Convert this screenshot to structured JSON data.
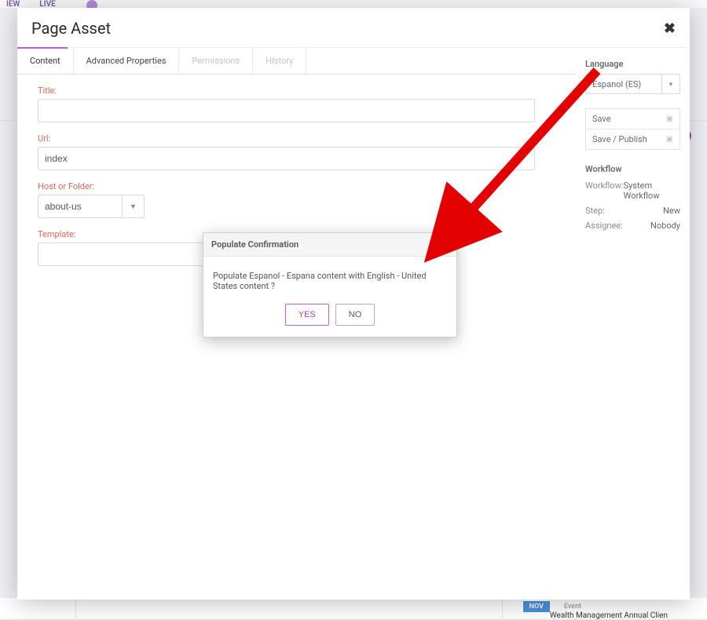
{
  "bg": {
    "tab1": "IEW",
    "tab2": "LIVE",
    "nov_badge": "NOV",
    "event_label": "Event",
    "wm_text": "Wealth Management Annual Clien"
  },
  "modal": {
    "title": "Page Asset",
    "tabs": {
      "content": "Content",
      "advanced": "Advanced Properties",
      "permissions": "Permissions",
      "history": "History"
    },
    "form": {
      "title_label": "Title:",
      "title_value": "",
      "url_label": "Url:",
      "url_value": "index",
      "host_label": "Host or Folder:",
      "host_value": "about-us",
      "template_label": "Template:",
      "template_value": ""
    },
    "sidebar": {
      "language_label": "Language",
      "language_value": "Espanol (ES)",
      "actions": {
        "save": "Save",
        "save_publish": "Save / Publish"
      },
      "workflow": {
        "heading": "Workflow",
        "workflow_k": "Workflow:",
        "workflow_v": "System Workflow",
        "step_k": "Step:",
        "step_v": "New",
        "assignee_k": "Assignee:",
        "assignee_v": "Nobody"
      }
    }
  },
  "popup": {
    "title": "Populate Confirmation",
    "message": "Populate Espanol - Espana content with English - United States content ?",
    "yes": "YES",
    "no": "NO"
  }
}
